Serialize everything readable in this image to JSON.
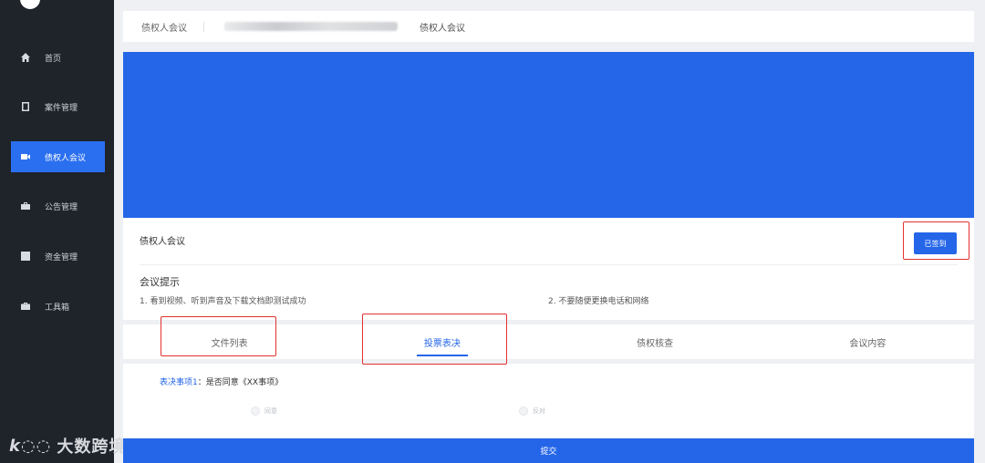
{
  "sidebar": {
    "items": [
      {
        "label": "首页",
        "icon": "home-icon"
      },
      {
        "label": "案件管理",
        "icon": "book-icon"
      },
      {
        "label": "债权人会议",
        "icon": "video-icon",
        "active": true
      },
      {
        "label": "公告管理",
        "icon": "briefcase-icon"
      },
      {
        "label": "资金管理",
        "icon": "yen-icon"
      },
      {
        "label": "工具箱",
        "icon": "toolbox-icon"
      }
    ]
  },
  "watermark": {
    "logo": "k◌◌",
    "text": "大数跨境"
  },
  "breadcrumb": {
    "first": "债权人会议",
    "last": "债权人会议"
  },
  "meeting": {
    "title": "债权人会议",
    "signed_label": "已签到",
    "tips_title": "会议提示",
    "tip1": "1. 看到视频、听到声音及下载文档即测试成功",
    "tip2": "2. 不要随便更换电话和网络"
  },
  "tabs": [
    {
      "label": "文件列表"
    },
    {
      "label": "投票表决",
      "active": true
    },
    {
      "label": "债权核查"
    },
    {
      "label": "会议内容"
    }
  ],
  "vote": {
    "item_label": "表决事项1",
    "item_text": "：是否同意《XX事项》",
    "option_agree": "同意",
    "option_oppose": "反对"
  },
  "submit_label": "提交",
  "colors": {
    "accent": "#2566e8",
    "sidebar": "#1f232a",
    "highlight": "#e2322f"
  }
}
